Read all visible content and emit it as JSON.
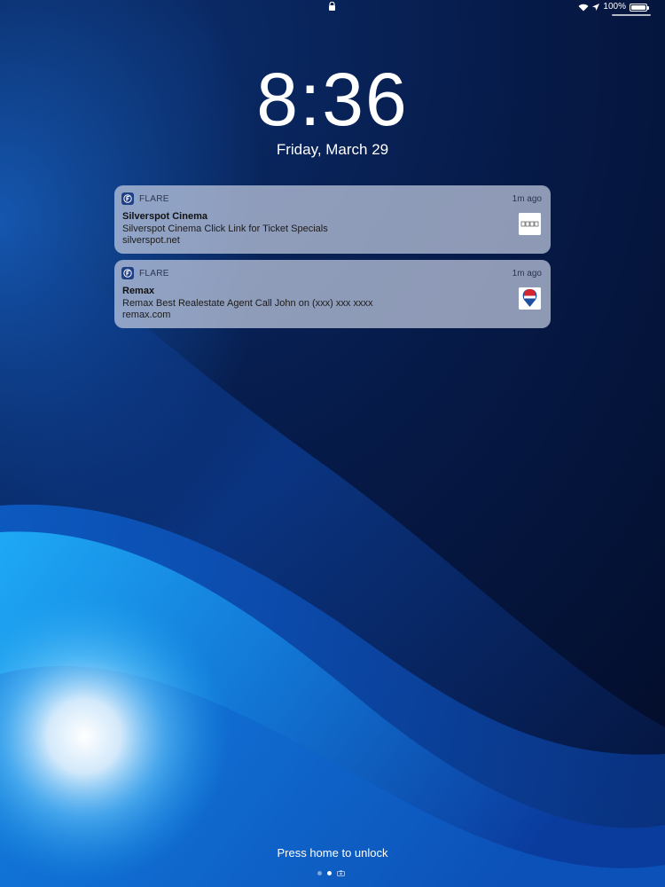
{
  "status_bar": {
    "battery_percent": "100%",
    "battery_level": 1.0
  },
  "lock_screen": {
    "time": "8:36",
    "date": "Friday, March 29"
  },
  "notifications": [
    {
      "app_name": "FLARE",
      "time_ago": "1m ago",
      "title": "Silverspot Cinema",
      "body": "Silverspot Cinema Click Link for Ticket Specials",
      "link": "silverspot.net",
      "thumbnail_icon": "silverspot-logo-icon"
    },
    {
      "app_name": "FLARE",
      "time_ago": "1m ago",
      "title": "Remax",
      "body": "Remax Best Realestate Agent Call John on (xxx) xxx xxxx",
      "link": "remax.com",
      "thumbnail_icon": "remax-balloon-icon"
    }
  ],
  "bottom": {
    "unlock_hint": "Press home to unlock",
    "page_indicator": {
      "pages": 3,
      "current": 2
    }
  },
  "colors": {
    "wallpaper_dark": "#041232",
    "wallpaper_mid": "#0c3a8c",
    "wallpaper_bright": "#1aa7f0",
    "notification_bg": "#c4cce0",
    "app_icon": "#1f3f86"
  }
}
